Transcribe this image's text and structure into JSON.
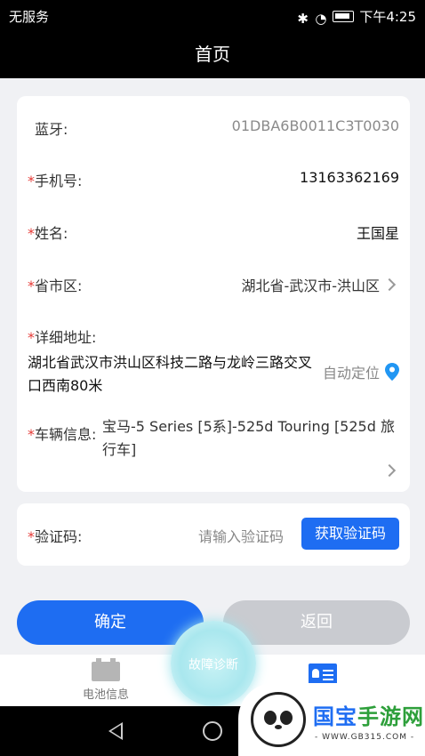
{
  "status_bar": {
    "carrier": "无服务",
    "time": "下午4:25"
  },
  "header": {
    "title": "首页"
  },
  "form": {
    "bluetooth": {
      "label": "蓝牙:",
      "value": "01DBA6B0011C3T0030"
    },
    "phone": {
      "required_mark": "*",
      "label": "手机号:",
      "value": "13163362169"
    },
    "name": {
      "required_mark": "*",
      "label": "姓名:",
      "value": "王国星"
    },
    "region": {
      "required_mark": "*",
      "label": "省市区:",
      "value": "湖北省-武汉市-洪山区"
    },
    "address": {
      "required_mark": "*",
      "label": "详细地址:",
      "value": "湖北省武汉市洪山区科技二路与龙岭三路交叉口西南80米",
      "auto_locate_label": "自动定位"
    },
    "vehicle": {
      "required_mark": "*",
      "label": "车辆信息:",
      "value": "宝马-5 Series [5系]-525d Touring [525d 旅行车]"
    }
  },
  "verification": {
    "required_mark": "*",
    "label": "验证码:",
    "placeholder": "请输入验证码",
    "button_label": "获取验证码"
  },
  "actions": {
    "confirm_label": "确定",
    "back_label": "返回"
  },
  "tabbar": {
    "battery_label": "电池信息",
    "diagnose_label": "故障诊断"
  },
  "watermark": {
    "brand_a": "国宝",
    "brand_b": "手游网",
    "url": "- WWW.GB315.COM -"
  },
  "colors": {
    "accent": "#1e6df2",
    "required": "#e53935",
    "disabled": "#c9cbd0"
  }
}
